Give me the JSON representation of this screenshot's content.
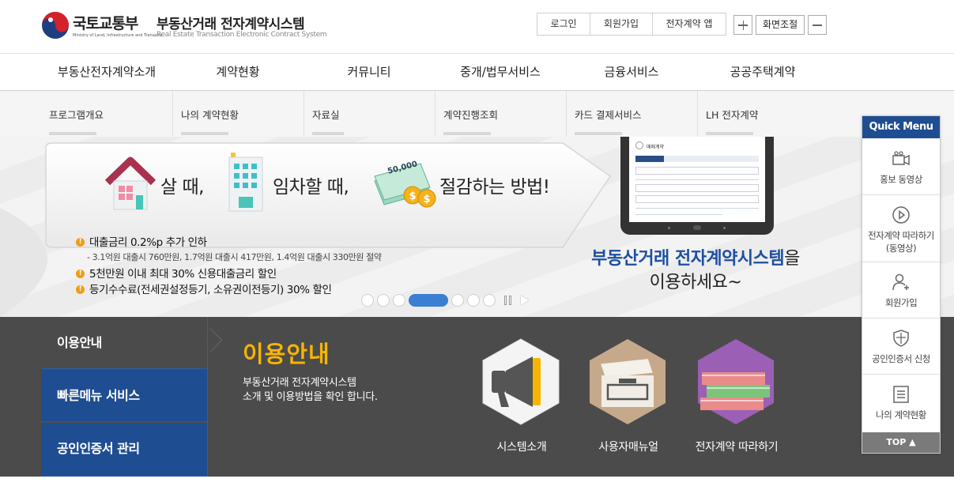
{
  "header": {
    "ministry_name": "국토교통부",
    "ministry_eng": "Ministry of Land, Infrastructure and Transport",
    "system_name": "부동산거래 전자계약시스템",
    "system_eng": "Real Estate Transaction Electronic Contract System",
    "util": [
      "로그인",
      "회원가입",
      "전자계약 앱"
    ],
    "zoom_label": "화면조절"
  },
  "gnb": [
    "부동산전자계약소개",
    "계약현황",
    "커뮤니티",
    "중개/법무서비스",
    "금융서비스",
    "공공주택계약"
  ],
  "submenu": [
    "프로그램개요",
    "나의 계약현황",
    "자료실",
    "계약진행조회",
    "카드 결제서비스",
    "LH 전자계약"
  ],
  "banner": {
    "buy": "살 때,",
    "rent": "임차할 때,",
    "save": "절감하는 방법!",
    "money_tag": "50,000",
    "bullet1": "대출금리 0.2%p 추가 인하",
    "bullet1_sub": "- 3.1억원 대출시 760만원, 1.7억원 대출시 417만원, 1.4억원 대출시 330만원 절약",
    "bullet2": "5천만원 이내 최대 30% 신용대출금리 할인",
    "bullet3": "등기수수료(전세권설정등기, 소유권이전등기) 30% 할인",
    "title_highlight": "부동산거래 전자계약시스템",
    "title_rest": "을",
    "title_line2": "이용하세요~",
    "screen_title": "매매계약"
  },
  "info": {
    "tabs": [
      "이용안내",
      "빠른메뉴 서비스",
      "공인인증서 관리"
    ],
    "title": "이용안내",
    "desc_line1": "부동산거래 전자계약시스템",
    "desc_line2": "소개 및 이용방법을 확인 합니다.",
    "items": [
      "시스템소개",
      "사용자매뉴얼",
      "전자계약 따라하기"
    ]
  },
  "quick": {
    "title": "Quick Menu",
    "items": [
      "홍보 동영상",
      "전자계약 따라하기",
      "회원가입",
      "공인인증서 신청",
      "나의 계약현황"
    ],
    "item2_sub": "(동영상)",
    "top": "TOP ▲"
  },
  "colors": {
    "brand_blue": "#1f4d91",
    "accent_yellow": "#f7b500",
    "dark_section": "#4b4b4b"
  }
}
